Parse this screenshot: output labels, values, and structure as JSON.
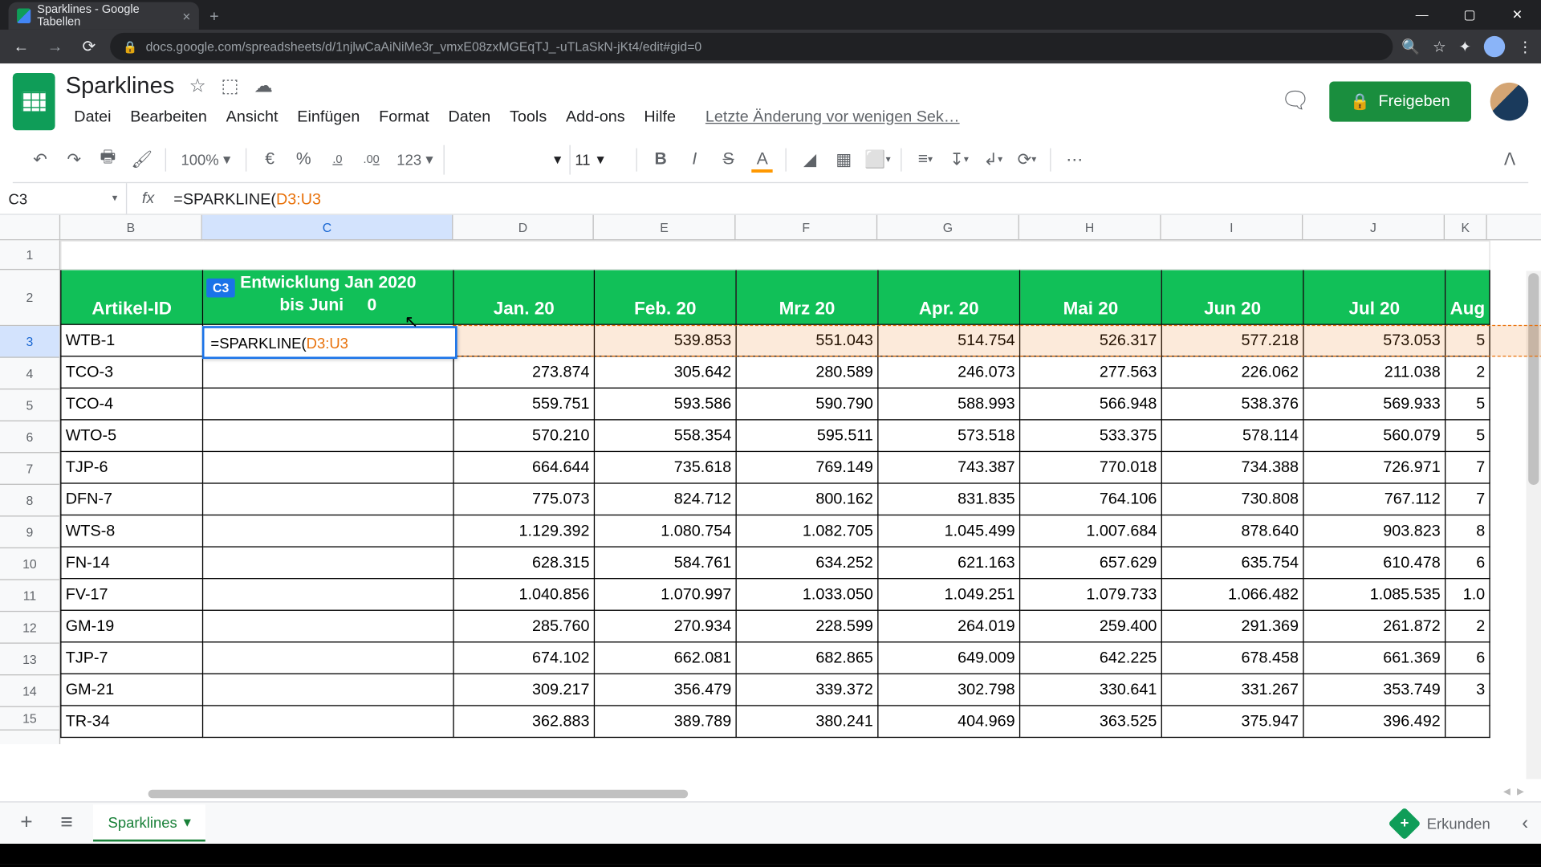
{
  "browser": {
    "tab_title": "Sparklines - Google Tabellen",
    "url": "docs.google.com/spreadsheets/d/1njlwCaAiNiMe3r_vmxE08zxMGEqTJ_-uTLaSkN-jKt4/edit#gid=0"
  },
  "doc": {
    "title": "Sparklines",
    "menus": [
      "Datei",
      "Bearbeiten",
      "Ansicht",
      "Einfügen",
      "Format",
      "Daten",
      "Tools",
      "Add-ons",
      "Hilfe"
    ],
    "history": "Letzte Änderung vor wenigen Sek…",
    "share": "Freigeben"
  },
  "toolbar": {
    "zoom": "100%",
    "currency": "€",
    "percent": "%",
    "dec_less": ".0",
    "dec_more": ".00",
    "numfmt": "123",
    "font_size": "11",
    "bold": "B",
    "italic": "I",
    "strike": "S",
    "text_color": "A",
    "fill_color_hex": "#ff9800",
    "more": "⋯"
  },
  "namebox": "C3",
  "formula": {
    "prefix": "=SPARKLINE(",
    "range": "D3:U3"
  },
  "cell_badge": "C3",
  "columns": [
    "B",
    "C",
    "D",
    "E",
    "F",
    "G",
    "H",
    "I",
    "J",
    "K"
  ],
  "col_widths": {
    "B": 134,
    "C": 237,
    "D": 133,
    "other": 134
  },
  "headers": {
    "artikel": "Artikel-ID",
    "entwicklung_l1": "Entwicklung Jan 2020",
    "entwicklung_l2": "bis Juni",
    "entwicklung_suffix": "0",
    "months": [
      "Jan. 20",
      "Feb. 20",
      "Mrz 20",
      "Apr. 20",
      "Mai 20",
      "Jun 20",
      "Jul 20",
      "Aug"
    ]
  },
  "rows": [
    {
      "n": 3,
      "id": "WTB-1",
      "d": [
        "",
        "539.853",
        "551.043",
        "514.754",
        "526.317",
        "577.218",
        "573.053",
        "5"
      ]
    },
    {
      "n": 4,
      "id": "TCO-3",
      "d": [
        "273.874",
        "305.642",
        "280.589",
        "246.073",
        "277.563",
        "226.062",
        "211.038",
        "2"
      ]
    },
    {
      "n": 5,
      "id": "TCO-4",
      "d": [
        "559.751",
        "593.586",
        "590.790",
        "588.993",
        "566.948",
        "538.376",
        "569.933",
        "5"
      ]
    },
    {
      "n": 6,
      "id": "WTO-5",
      "d": [
        "570.210",
        "558.354",
        "595.511",
        "573.518",
        "533.375",
        "578.114",
        "560.079",
        "5"
      ]
    },
    {
      "n": 7,
      "id": "TJP-6",
      "d": [
        "664.644",
        "735.618",
        "769.149",
        "743.387",
        "770.018",
        "734.388",
        "726.971",
        "7"
      ]
    },
    {
      "n": 8,
      "id": "DFN-7",
      "d": [
        "775.073",
        "824.712",
        "800.162",
        "831.835",
        "764.106",
        "730.808",
        "767.112",
        "7"
      ]
    },
    {
      "n": 9,
      "id": "WTS-8",
      "d": [
        "1.129.392",
        "1.080.754",
        "1.082.705",
        "1.045.499",
        "1.007.684",
        "878.640",
        "903.823",
        "8"
      ]
    },
    {
      "n": 10,
      "id": "FN-14",
      "d": [
        "628.315",
        "584.761",
        "634.252",
        "621.163",
        "657.629",
        "635.754",
        "610.478",
        "6"
      ]
    },
    {
      "n": 11,
      "id": "FV-17",
      "d": [
        "1.040.856",
        "1.070.997",
        "1.033.050",
        "1.049.251",
        "1.079.733",
        "1.066.482",
        "1.085.535",
        "1.0"
      ]
    },
    {
      "n": 12,
      "id": "GM-19",
      "d": [
        "285.760",
        "270.934",
        "228.599",
        "264.019",
        "259.400",
        "291.369",
        "261.872",
        "2"
      ]
    },
    {
      "n": 13,
      "id": "TJP-7",
      "d": [
        "674.102",
        "662.081",
        "682.865",
        "649.009",
        "642.225",
        "678.458",
        "661.369",
        "6"
      ]
    },
    {
      "n": 14,
      "id": "GM-21",
      "d": [
        "309.217",
        "356.479",
        "339.372",
        "302.798",
        "330.641",
        "331.267",
        "353.749",
        "3"
      ]
    },
    {
      "n": 15,
      "id": "TR-34",
      "d": [
        "362.883",
        "389.789",
        "380.241",
        "404.969",
        "363.525",
        "375.947",
        "396.492",
        ""
      ]
    }
  ],
  "sheet_tab": "Sparklines",
  "explore": "Erkunden"
}
